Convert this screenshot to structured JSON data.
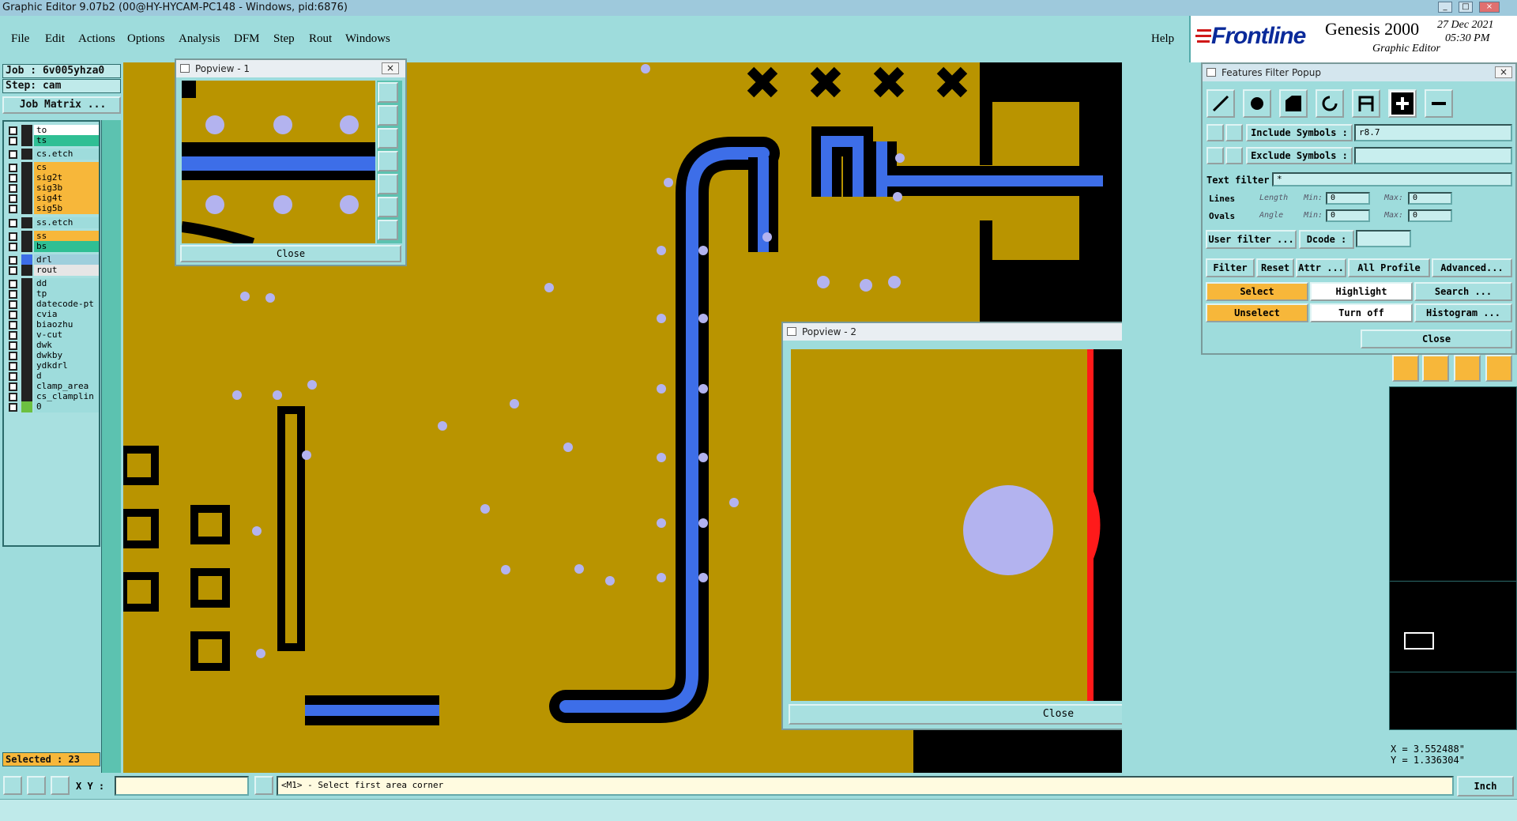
{
  "window": {
    "title": "Graphic Editor 9.07b2 (00@HY-HYCAM-PC148 - Windows, pid:6876)"
  },
  "menu": [
    "File",
    "Edit",
    "Actions",
    "Options",
    "Analysis",
    "DFM",
    "Step",
    "Rout",
    "Windows"
  ],
  "help": "Help",
  "brand": {
    "name": "Frontline",
    "product": "Genesis 2000",
    "subtitle": "Graphic Editor",
    "date": "27 Dec 2021",
    "time": "05:30 PM"
  },
  "job": {
    "job_label": "Job : 6v005yhza0",
    "step_label": "Step: cam",
    "matrix_button": "Job Matrix ..."
  },
  "layers": [
    {
      "name": "to",
      "color": "#ffffff"
    },
    {
      "name": "ts",
      "color": "#2fbf94"
    },
    {
      "name": "cs.etch",
      "color": "#9edcdc"
    },
    {
      "name": "cs",
      "color": "#f7b73a"
    },
    {
      "name": "sig2t",
      "color": "#f7b73a"
    },
    {
      "name": "sig3b",
      "color": "#f7b73a"
    },
    {
      "name": "sig4t",
      "color": "#f7b73a"
    },
    {
      "name": "sig5b",
      "color": "#f7b73a"
    },
    {
      "name": "ss.etch",
      "color": "#9edcdc"
    },
    {
      "name": "ss",
      "color": "#f7b73a"
    },
    {
      "name": "bs",
      "color": "#2fbf94"
    },
    {
      "name": "drl",
      "color": "#9ecfdc"
    },
    {
      "name": "rout",
      "color": "#e6e6e6"
    },
    {
      "name": "dd",
      "color": "#9edcdc"
    },
    {
      "name": "tp",
      "color": "#9edcdc"
    },
    {
      "name": "datecode-pt",
      "color": "#9edcdc"
    },
    {
      "name": "cvia",
      "color": "#9edcdc"
    },
    {
      "name": "biaozhu",
      "color": "#9edcdc"
    },
    {
      "name": "v-cut",
      "color": "#9edcdc"
    },
    {
      "name": "dwk",
      "color": "#9edcdc"
    },
    {
      "name": "dwkby",
      "color": "#9edcdc"
    },
    {
      "name": "ydkdrl",
      "color": "#9edcdc"
    },
    {
      "name": "d",
      "color": "#9edcdc"
    },
    {
      "name": "clamp_area",
      "color": "#9edcdc"
    },
    {
      "name": "cs_clamplin",
      "color": "#9edcdc"
    },
    {
      "name": "0",
      "color": "#9edcdc"
    }
  ],
  "selected": "Selected : 23",
  "popview1": {
    "title": "Popview - 1",
    "close": "Close"
  },
  "popview2": {
    "title": "Popview - 2",
    "close": "Close"
  },
  "filter_popup": {
    "title": "Features Filter Popup",
    "include_label": "Include Symbols :",
    "include_value": "r8.7",
    "exclude_label": "Exclude Symbols :",
    "exclude_value": "",
    "text_filter_label": "Text filter",
    "text_filter_value": "*",
    "lines": "Lines",
    "ovals": "Ovals",
    "length": "Length",
    "angle": "Angle",
    "min": "Min:",
    "max": "Max:",
    "min_len": "0",
    "max_len": "0",
    "min_ang": "0",
    "max_ang": "0",
    "user_filter": "User filter ...",
    "dcode": "Dcode :",
    "filter": "Filter",
    "reset": "Reset",
    "attr": "Attr ...",
    "profile": "All Profile",
    "advanced": "Advanced...",
    "select": "Select",
    "highlight": "Highlight",
    "search": "Search ...",
    "unselect": "Unselect",
    "turnoff": "Turn off",
    "histogram": "Histogram ...",
    "close": "Close"
  },
  "coords": {
    "x": "X = 3.552488\"",
    "y": "Y = 1.336304\""
  },
  "status": {
    "xy_label": "X Y :",
    "xy_value": "",
    "prompt": "<M1> - Select first area corner",
    "units": "Inch"
  }
}
